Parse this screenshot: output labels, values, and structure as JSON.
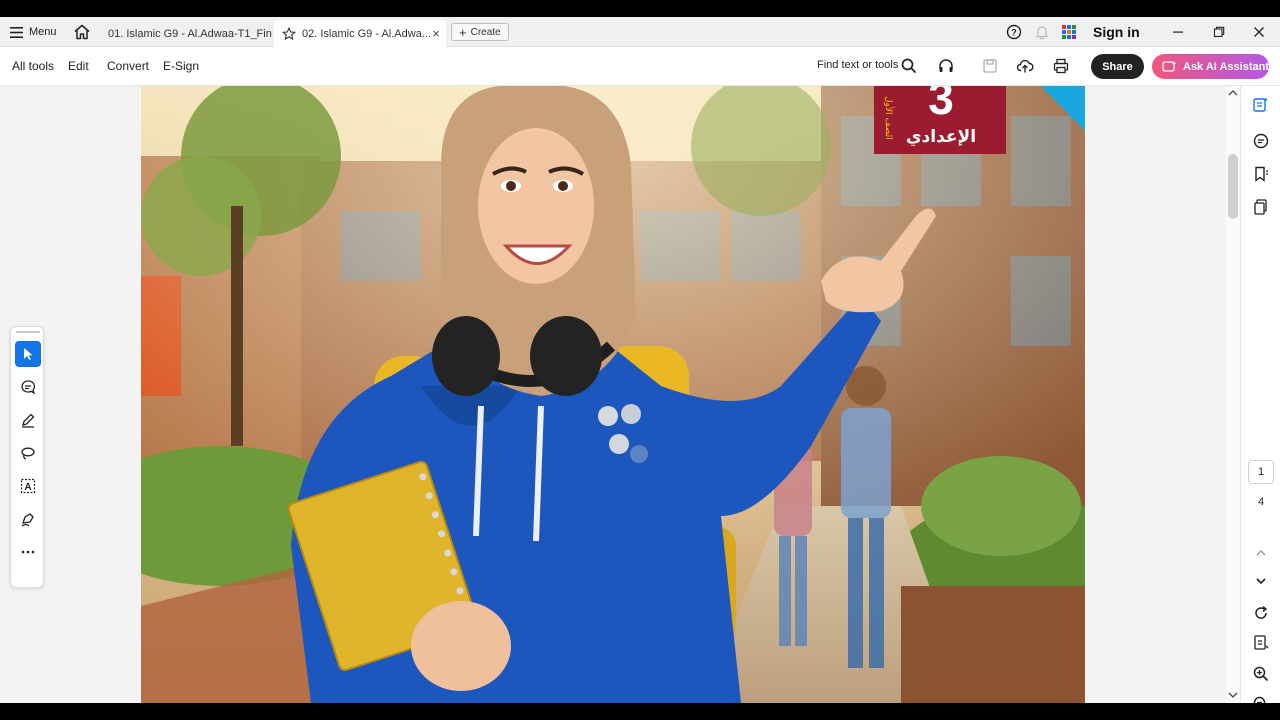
{
  "tabbar": {
    "menu_label": "Menu",
    "tabs": [
      {
        "label": "01. Islamic G9 - Al.Adwaa-T1_Fin..."
      },
      {
        "label": "02. Islamic G9 - Al.Adwa...",
        "close": "×"
      }
    ],
    "create_label": "Create",
    "sign_in": "Sign in"
  },
  "toolbar": {
    "menus": [
      "All tools",
      "Edit",
      "Convert",
      "E-Sign"
    ],
    "find_label": "Find text or tools",
    "share_label": "Share",
    "ai_label": "Ask AI Assistant"
  },
  "document": {
    "badge_text": "الإعدادي",
    "badge_subtext": "الصف الأول",
    "badge_number": "3"
  },
  "pagenav": {
    "current": "1",
    "total": "4"
  },
  "colors": {
    "accent": "#1473e6",
    "badge": "#9b1b30",
    "share_bg": "#222222",
    "ai_gradient_start": "#f0587a",
    "ai_gradient_end": "#b558e8"
  }
}
